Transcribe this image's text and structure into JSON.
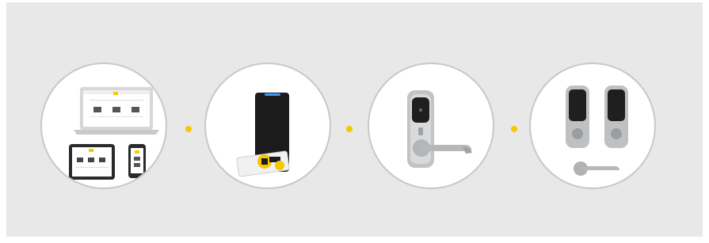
{
  "accent_color": "#f6c800",
  "steps": [
    {
      "name": "web-and-mobile-app",
      "icon": "devices-icon"
    },
    {
      "name": "card-reader",
      "icon": "card-reader-icon"
    },
    {
      "name": "lever-lock",
      "icon": "lever-lock-icon"
    },
    {
      "name": "deadbolt-and-lever",
      "icon": "deadbolt-icon"
    }
  ]
}
